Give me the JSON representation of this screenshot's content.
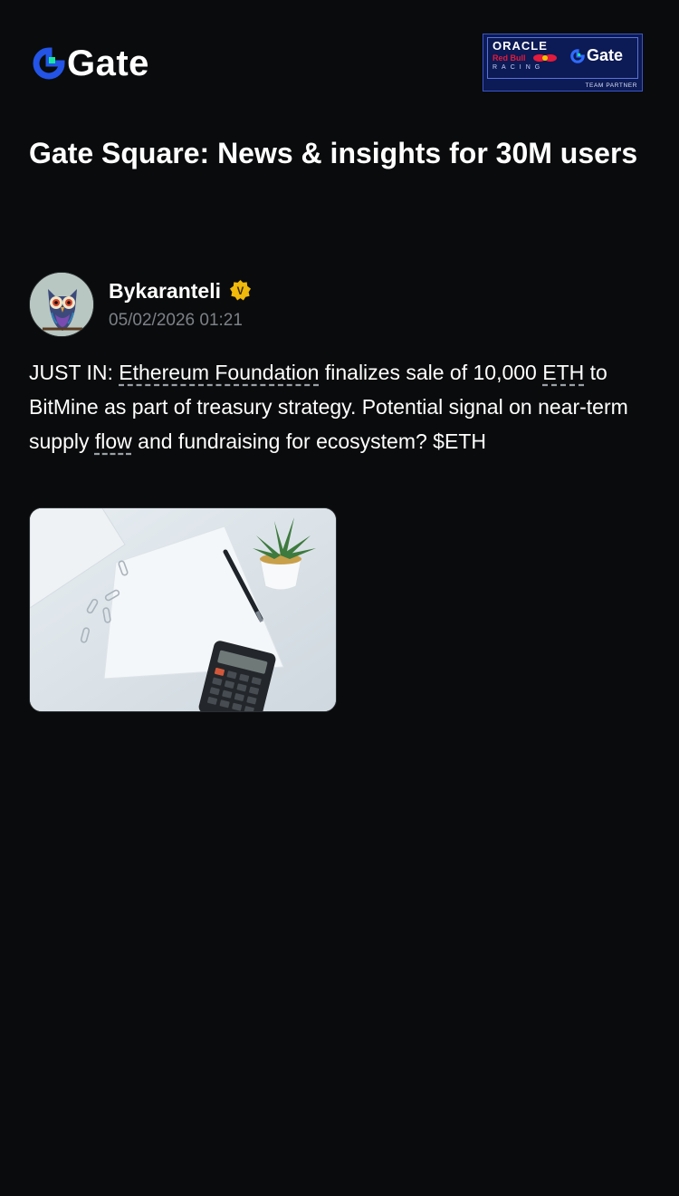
{
  "header": {
    "logo_text": "Gate",
    "partner": {
      "oracle": "ORACLE",
      "redbull": "Red Bull",
      "racing": "RACING",
      "gate": "Gate",
      "tag": "TEAM PARTNER"
    }
  },
  "page_title": "Gate Square: News & insights for 30M users",
  "post": {
    "author": "Bykaranteli",
    "verified_badge": "V",
    "timestamp": "05/02/2026 01:21",
    "text": {
      "p1": "JUST IN: ",
      "link1": "Ethereum Foundation",
      "p2": " finalizes sale of 10,000 ",
      "link2": "ETH",
      "p3": " to BitMine as part of treasury strategy. Potential signal on near-term supply ",
      "link3": "flow",
      "p4": " and fundraising for ecosystem? $ETH"
    }
  },
  "colors": {
    "background": "#0a0b0c",
    "brand_blue": "#2354e6",
    "brand_green": "#17e6a1",
    "timestamp_gray": "#7d8187",
    "verified_gold": "#f0b90b"
  },
  "icons": {
    "logo": "gate-logo-icon",
    "verified": "verified-badge-icon"
  }
}
